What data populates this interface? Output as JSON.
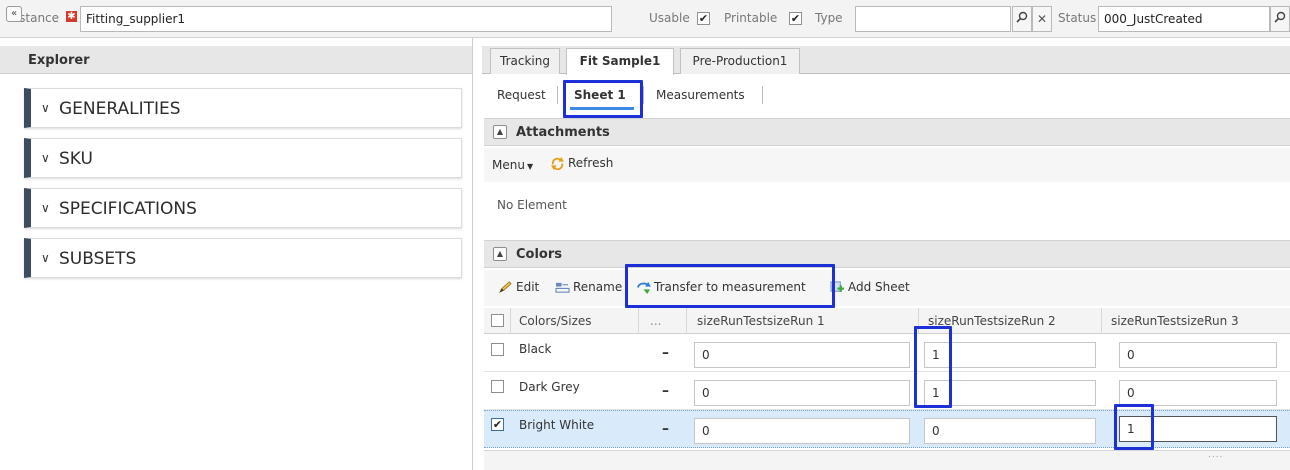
{
  "topbar": {
    "instance_label": "Instance",
    "instance_value": "Fitting_supplier1",
    "usable_label": "Usable",
    "printable_label": "Printable",
    "type_label": "Type",
    "type_value": "",
    "status_label": "Status",
    "status_value": "000_JustCreated",
    "usable_checked": "✔",
    "printable_checked": "✔"
  },
  "explorer": {
    "title": "Explorer",
    "collapse_glyph": "«",
    "sections": [
      {
        "label": "GENERALITIES"
      },
      {
        "label": "SKU"
      },
      {
        "label": "SPECIFICATIONS"
      },
      {
        "label": "SUBSETS"
      }
    ]
  },
  "tabs": [
    {
      "label": "Tracking"
    },
    {
      "label": "Fit Sample1"
    },
    {
      "label": "Pre-Production1"
    }
  ],
  "subtabs": [
    {
      "label": "Request"
    },
    {
      "label": "Sheet 1"
    },
    {
      "label": "Measurements"
    }
  ],
  "attachments": {
    "title": "Attachments",
    "menu_label": "Menu",
    "refresh_label": "Refresh",
    "empty_text": "No Element"
  },
  "colors": {
    "title": "Colors",
    "toolbar": {
      "edit": "Edit",
      "rename": "Rename",
      "transfer": "Transfer to measurement",
      "add_sheet": "Add Sheet"
    },
    "columns": [
      "Colors/Sizes",
      "...",
      "sizeRunTestsizeRun 1",
      "sizeRunTestsizeRun 2",
      "sizeRunTestsizeRun 3"
    ],
    "rows": [
      {
        "name": "Black",
        "dash": "–",
        "checked": "",
        "values": [
          "0",
          "1",
          "0"
        ]
      },
      {
        "name": "Dark Grey",
        "dash": "–",
        "checked": "",
        "values": [
          "0",
          "1",
          "0"
        ]
      },
      {
        "name": "Bright White",
        "dash": "–",
        "checked": "✔",
        "values": [
          "0",
          "0",
          "1"
        ]
      }
    ],
    "resize_grip": "....",
    "accent_color": "#1d2fd6"
  }
}
